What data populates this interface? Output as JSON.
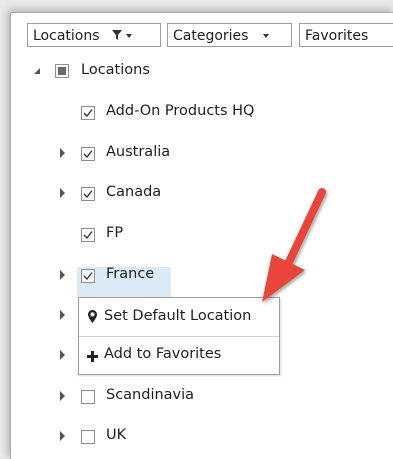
{
  "toolbar": {
    "locations_label": "Locations",
    "categories_label": "Categories",
    "favorites_label": "Favorites"
  },
  "tree": {
    "root_label": "Locations",
    "items": [
      {
        "label": "Add-On Products HQ",
        "checked": true,
        "expandable": false
      },
      {
        "label": "Australia",
        "checked": true,
        "expandable": true
      },
      {
        "label": "Canada",
        "checked": true,
        "expandable": true
      },
      {
        "label": "FP",
        "checked": true,
        "expandable": false
      },
      {
        "label": "France",
        "checked": true,
        "expandable": true,
        "selected": true
      },
      {
        "label": "Scandinavia",
        "checked": false,
        "expandable": true
      },
      {
        "label": "UK",
        "checked": false,
        "expandable": true
      }
    ]
  },
  "context_menu": {
    "items": [
      {
        "label": "Set Default Location",
        "icon": "location-pin-icon"
      },
      {
        "label": "Add to Favorites",
        "icon": "plus-icon"
      }
    ]
  },
  "colors": {
    "selection": "#dcebf7",
    "annotation_arrow": "#e8443a"
  }
}
